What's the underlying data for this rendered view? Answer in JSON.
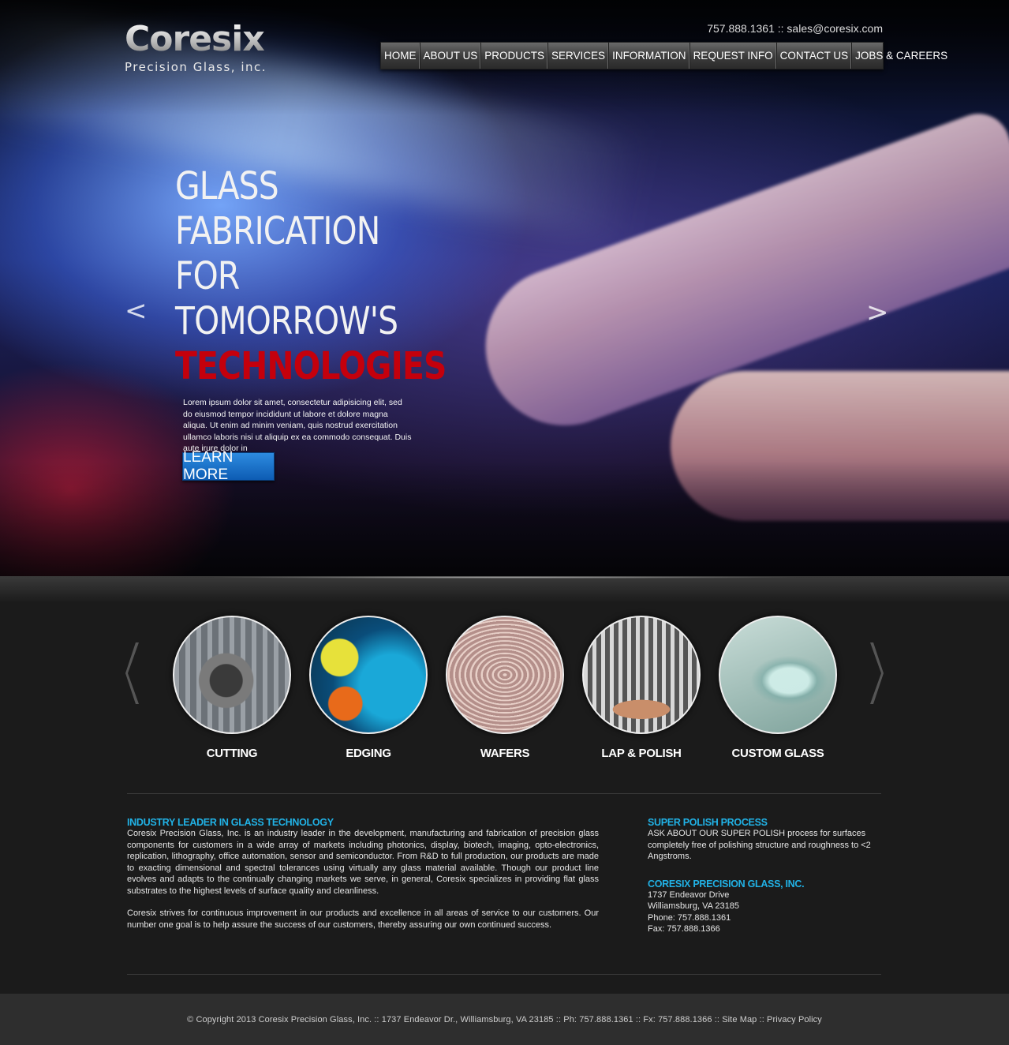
{
  "brand": {
    "name": "Coresix",
    "tagline": "Precision Glass, inc."
  },
  "top_contact": "757.888.1361 :: sales@coresix.com",
  "nav": [
    "HOME",
    "ABOUT US",
    "PRODUCTS",
    "SERVICES",
    "INFORMATION",
    "REQUEST INFO",
    "CONTACT US",
    "JOBS & CAREERS"
  ],
  "hero": {
    "headline_lines": [
      "GLASS",
      "FABRICATION",
      "FOR",
      "TOMORROW'S"
    ],
    "headline_accent": "TECHNOLOGIES",
    "body": "Lorem ipsum dolor sit amet, consectetur adipisicing elit, sed do eiusmod tempor incididunt ut labore et dolore magna aliqua. Ut enim ad minim veniam, quis nostrud exercitation ullamco laboris nisi ut aliquip ex ea commodo consequat. Duis aute irure dolor in",
    "button": "LEARN MORE",
    "prev_icon": "<",
    "next_icon": ">"
  },
  "services": [
    {
      "label": "CUTTING"
    },
    {
      "label": "EDGING"
    },
    {
      "label": "WAFERS"
    },
    {
      "label": "LAP & POLISH"
    },
    {
      "label": "CUSTOM GLASS"
    }
  ],
  "info": {
    "left_heading": "INDUSTRY LEADER IN GLASS TECHNOLOGY",
    "left_p1": "Coresix Precision Glass, Inc. is an industry leader in the development, manufacturing and fabrication of precision glass components for customers in a wide array of markets including photonics, display, biotech, imaging, opto-electronics, replication, lithography, office automation, sensor and semiconductor. From R&D to full production, our products are made to exacting dimensional and spectral tolerances using virtually any glass material available. Though our product line evolves and adapts to the continually changing markets we serve, in general, Coresix specializes in providing flat glass substrates to the highest levels of surface quality and cleanliness.",
    "left_p2": "Coresix strives for continuous improvement in our products and excellence in all areas of service to our customers. Our number one goal is to help assure the success of our customers, thereby assuring our own continued success.",
    "right_heading1": "SUPER POLISH PROCESS",
    "right_p1": "ASK ABOUT OUR SUPER POLISH process for surfaces completely free of polishing structure and roughness to <2 Angstroms.",
    "right_heading2": "CORESIX PRECISION GLASS, INC.",
    "address": [
      "1737 Endeavor Drive",
      "Williamsburg, VA 23185",
      "Phone: 757.888.1361",
      "Fax: 757.888.1366"
    ]
  },
  "footer": "© Copyright 2013 Coresix Precision Glass, Inc. :: 1737 Endeavor Dr., Williamsburg, VA 23185 :: Ph: 757.888.1361 :: Fx: 757.888.1366 :: Site Map :: Privacy Policy"
}
